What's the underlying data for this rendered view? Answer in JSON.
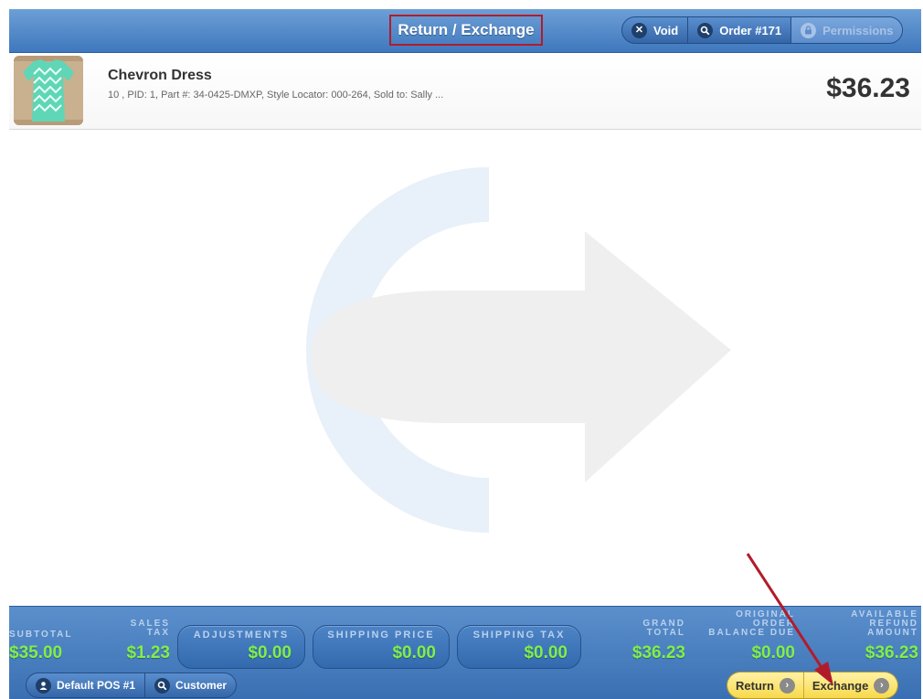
{
  "header": {
    "title": "Return / Exchange",
    "buttons": {
      "void_label": "Void",
      "order_label": "Order #171",
      "permissions_label": "Permissions"
    }
  },
  "item": {
    "name": "Chevron Dress",
    "description": "10 , PID: 1, Part #: 34-0425-DMXP, Style Locator: 000-264, Sold to: Sally ...",
    "price": "$36.23"
  },
  "totals": {
    "subtotal": {
      "label": "SUBTOTAL",
      "value": "$35.00"
    },
    "sales_tax": {
      "label_line1": "SALES",
      "label_line2": "TAX",
      "value": "$1.23"
    },
    "adjustments": {
      "label": "ADJUSTMENTS",
      "value": "$0.00"
    },
    "shipping_price": {
      "label": "SHIPPING PRICE",
      "value": "$0.00"
    },
    "shipping_tax": {
      "label": "SHIPPING TAX",
      "value": "$0.00"
    },
    "grand_total": {
      "label_line1": "GRAND",
      "label_line2": "TOTAL",
      "value": "$36.23"
    },
    "original_order_balance_due": {
      "label_line1": "ORIGINAL",
      "label_line2": "ORDER",
      "label_line3": "BALANCE DUE",
      "value": "$0.00"
    },
    "available_refund_amount": {
      "label_line1": "AVAILABLE",
      "label_line2": "REFUND",
      "label_line3": "AMOUNT",
      "value": "$36.23"
    }
  },
  "footer": {
    "pos_label": "Default POS #1",
    "customer_label": "Customer",
    "return_label": "Return",
    "exchange_label": "Exchange"
  },
  "colors": {
    "header_blue": "#4a82c4",
    "total_green": "#7ff04a",
    "annotation_red": "#b11c2a",
    "action_yellow": "#f7d94b"
  },
  "icons": {
    "void": "close-circle-icon",
    "order": "search-icon",
    "permissions": "lock-icon",
    "pos": "user-icon",
    "customer": "search-icon",
    "return": "chevron-right-circle-icon",
    "exchange": "chevron-right-circle-icon"
  }
}
